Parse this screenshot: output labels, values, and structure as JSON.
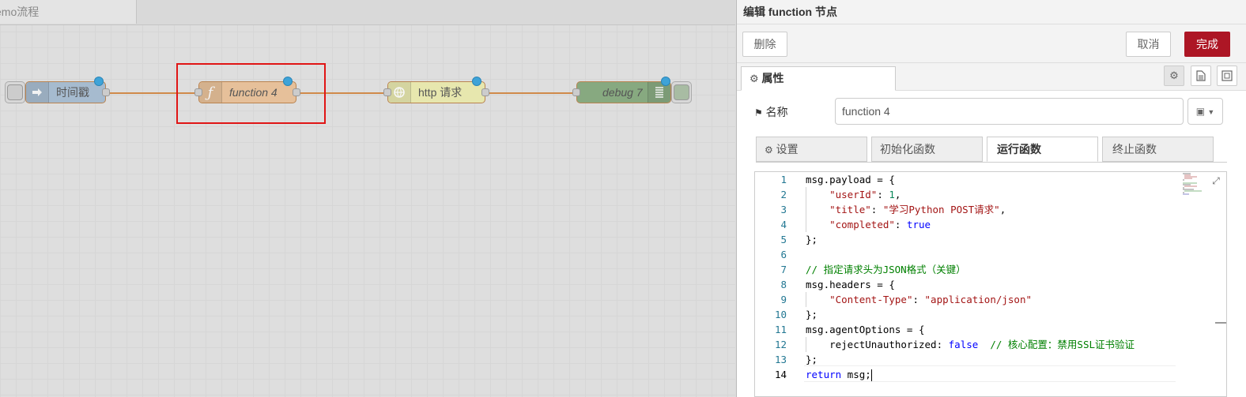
{
  "canvas": {
    "tab_label": "emo流程",
    "nodes": {
      "inject": {
        "label": "时间戳",
        "icon": "arrow-right-icon",
        "color": "#a6bbcf"
      },
      "function": {
        "label": "function 4",
        "icon": "function-icon",
        "color": "#fdd0a2"
      },
      "http": {
        "label": "http 请求",
        "icon": "globe-icon",
        "color": "#e7e7ae"
      },
      "debug": {
        "label": "debug 7",
        "icon": "list-icon",
        "color": "#87a980"
      }
    },
    "wire_color": "#d08a4a",
    "selection_color": "#e01515"
  },
  "panel": {
    "title": "编辑 function 节点",
    "buttons": {
      "delete": "删除",
      "cancel": "取消",
      "done": "完成"
    },
    "primary_color": "#ad1625",
    "tab_properties": "属性",
    "name_label": "名称",
    "name_value": "function 4",
    "subtabs": [
      "设置",
      "初始化函数",
      "运行函数",
      "终止函数"
    ],
    "active_subtab": "运行函数"
  },
  "code": {
    "lines": [
      {
        "n": "1"
      },
      {
        "n": "2"
      },
      {
        "n": "3"
      },
      {
        "n": "4"
      },
      {
        "n": "5"
      },
      {
        "n": "6"
      },
      {
        "n": "7"
      },
      {
        "n": "8"
      },
      {
        "n": "9"
      },
      {
        "n": "10"
      },
      {
        "n": "11"
      },
      {
        "n": "12"
      },
      {
        "n": "13"
      },
      {
        "n": "14"
      }
    ],
    "tokens": {
      "l1": "msg.payload = {",
      "l2_key": "\"userId\"",
      "l2_sep": ": ",
      "l2_val": "1",
      "l2_end": ",",
      "l3_key": "\"title\"",
      "l3_sep": ": ",
      "l3_val": "\"学习Python POST请求\"",
      "l3_end": ",",
      "l4_key": "\"completed\"",
      "l4_sep": ": ",
      "l4_val": "true",
      "l5": "};",
      "l7": "// 指定请求头为JSON格式（关键）",
      "l8": "msg.headers = {",
      "l9_key": "\"Content-Type\"",
      "l9_sep": ": ",
      "l9_val": "\"application/json\"",
      "l10": "};",
      "l11": "msg.agentOptions = {",
      "l12_key": "rejectUnauthorized",
      "l12_sep": ": ",
      "l12_val": "false",
      "l12_cmt": "// 核心配置：禁用SSL证书验证",
      "l13": "};",
      "l14_kw": "return",
      "l14_rest": " msg;"
    }
  }
}
